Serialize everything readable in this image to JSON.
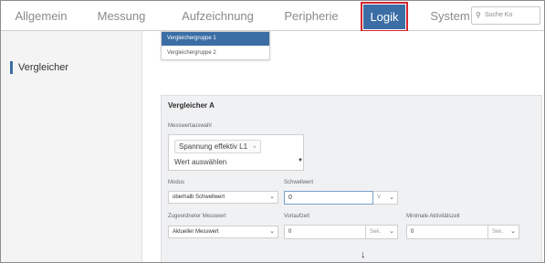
{
  "nav": {
    "tabs": [
      {
        "label": "Allgemein"
      },
      {
        "label": "Messung"
      },
      {
        "label": "Aufzeichnung"
      },
      {
        "label": "Peripherie"
      },
      {
        "label": "Logik",
        "active": true
      },
      {
        "label": "System"
      }
    ],
    "search_placeholder": "Suche Ko",
    "search_icon": "search-icon"
  },
  "sidebar": {
    "items": [
      {
        "label": "Vergleicher",
        "active": true
      }
    ]
  },
  "group_menu": {
    "items": [
      {
        "label": "Vergleichergruppe 1",
        "selected": true
      },
      {
        "label": "Vergleichergruppe 2"
      }
    ]
  },
  "comparator": {
    "title": "Vergleicher A",
    "messwert_label": "Messwertauswahl",
    "selected_value": "Spannung effektiv L1",
    "remove_icon": "close-icon",
    "select_placeholder": "Wert auswählen",
    "modus_label": "Modus",
    "modus_value": "oberhalb Schwellwert",
    "schwellwert_label": "Schwellwert",
    "schwellwert_value": "0",
    "schwellwert_unit": "V",
    "zugeordnet_label": "Zugeordneter Messwert",
    "zugeordnet_value": "Aktueller Messwert",
    "vorlauf_label": "Vorlaufzeit",
    "vorlauf_value": "0",
    "vorlauf_unit": "Sek.",
    "minakt_label": "Minimale Aktivitätszeit",
    "minakt_value": "0",
    "minakt_unit": "Sek.",
    "arrow_icon": "arrow-down-icon"
  },
  "colors": {
    "accent": "#3b6ea5",
    "highlight_frame": "#d4262c"
  }
}
